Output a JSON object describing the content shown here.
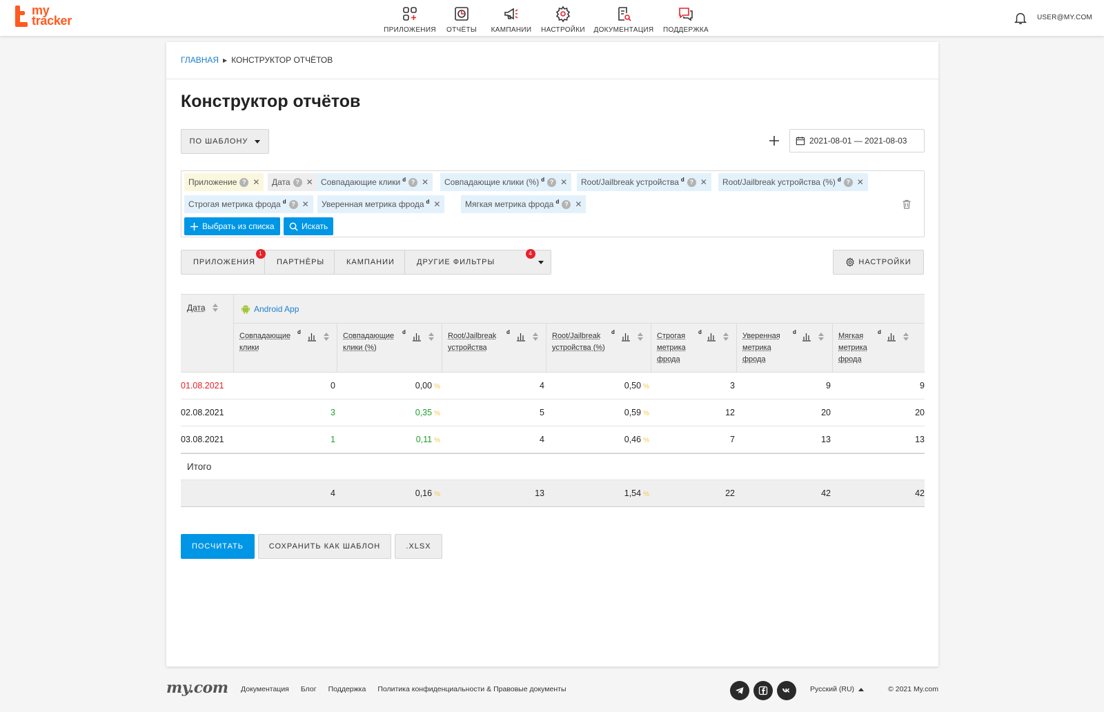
{
  "brand": {
    "line1": "my",
    "line2": "tracker",
    "accent": "#ff5a1f"
  },
  "nav": [
    {
      "label": "ПРИЛОЖЕНИЯ",
      "icon": "apps-icon"
    },
    {
      "label": "ОТЧЁТЫ",
      "icon": "reports-icon"
    },
    {
      "label": "КАМПАНИИ",
      "icon": "megaphone-icon"
    },
    {
      "label": "НАСТРОЙКИ",
      "icon": "gear-icon"
    },
    {
      "label": "ДОКУМЕНТАЦИЯ",
      "icon": "docs-icon"
    },
    {
      "label": "ПОДДЕРЖКА",
      "icon": "chat-icon"
    }
  ],
  "user": "USER@MY.COM",
  "breadcrumb": {
    "home": "ГЛАВНАЯ",
    "current": "КОНСТРУКТОР ОТЧЁТОВ"
  },
  "page_title": "Конструктор отчётов",
  "template_button": "ПО ШАБЛОНУ",
  "date_range": "2021-08-01 — 2021-08-03",
  "chips": [
    {
      "label": "Приложение",
      "sup": "",
      "color": "yellow"
    },
    {
      "label": "Дата",
      "sup": "",
      "color": "gray"
    },
    {
      "label": "Совпадающие клики",
      "sup": "d",
      "color": "blue"
    },
    {
      "label": "Совпадающие клики (%)",
      "sup": "d",
      "color": "blue"
    },
    {
      "label": "Root/Jailbreak устройства",
      "sup": "d",
      "color": "blue"
    },
    {
      "label": "Root/Jailbreak устройства (%)",
      "sup": "d",
      "color": "blue"
    },
    {
      "label": "Строгая метрика фрода",
      "sup": "d",
      "color": "blue"
    },
    {
      "label": "Уверенная метрика фрода",
      "sup": "d",
      "color": "blue"
    },
    {
      "label": "Мягкая метрика фрода",
      "sup": "d",
      "color": "blue"
    }
  ],
  "chip_actions": {
    "select": "Выбрать из списка",
    "search": "Искать"
  },
  "filter_tabs": [
    {
      "label": "ПРИЛОЖЕНИЯ",
      "badge": "1"
    },
    {
      "label": "ПАРТНЁРЫ",
      "badge": ""
    },
    {
      "label": "КАМПАНИИ",
      "badge": ""
    },
    {
      "label": "ДРУГИЕ ФИЛЬТРЫ",
      "badge": "4"
    }
  ],
  "settings_button": "НАСТРОЙКИ",
  "table": {
    "date_header": "Дата",
    "app_name": "Android App",
    "columns": [
      {
        "name": "Совпадающие клики",
        "d": "d"
      },
      {
        "name": "Совпадающие клики (%)",
        "d": "d"
      },
      {
        "name": "Root/Jailbreak устройства",
        "d": "d"
      },
      {
        "name": "Root/Jailbreak устройства (%)",
        "d": "d"
      },
      {
        "name": "Строгая метрика фрода",
        "d": "d"
      },
      {
        "name": "Уверенная метрика фрода",
        "d": "d"
      },
      {
        "name": "Мягкая метрика фрода",
        "d": "d"
      }
    ],
    "rows": [
      {
        "date": "01.08.2021",
        "date_color": "red",
        "values": [
          "0",
          "0,00",
          "4",
          "0,50",
          "3",
          "9",
          "9"
        ],
        "green": [
          false,
          false
        ]
      },
      {
        "date": "02.08.2021",
        "date_color": "normal",
        "values": [
          "3",
          "0,35",
          "5",
          "0,59",
          "12",
          "20",
          "20"
        ],
        "green": [
          true,
          true
        ]
      },
      {
        "date": "03.08.2021",
        "date_color": "normal",
        "values": [
          "1",
          "0,11",
          "4",
          "0,46",
          "7",
          "13",
          "13"
        ],
        "green": [
          true,
          true
        ]
      }
    ],
    "percent_sign": "%",
    "total_label": "Итого",
    "totals": [
      "4",
      "0,16",
      "13",
      "1,54",
      "22",
      "42",
      "42"
    ]
  },
  "actions": {
    "calculate": "ПОСЧИТАТЬ",
    "save_template": "СОХРАНИТЬ КАК ШАБЛОН",
    "xlsx": ".XLSX"
  },
  "footer": {
    "logo": "my.com",
    "links": [
      "Документация",
      "Блог",
      "Поддержка",
      "Политика конфиденциальности & Правовые документы"
    ],
    "social": [
      "telegram-icon",
      "facebook-icon",
      "vk-icon"
    ],
    "language": "Русский (RU)",
    "copyright": "© 2021 My.com"
  }
}
